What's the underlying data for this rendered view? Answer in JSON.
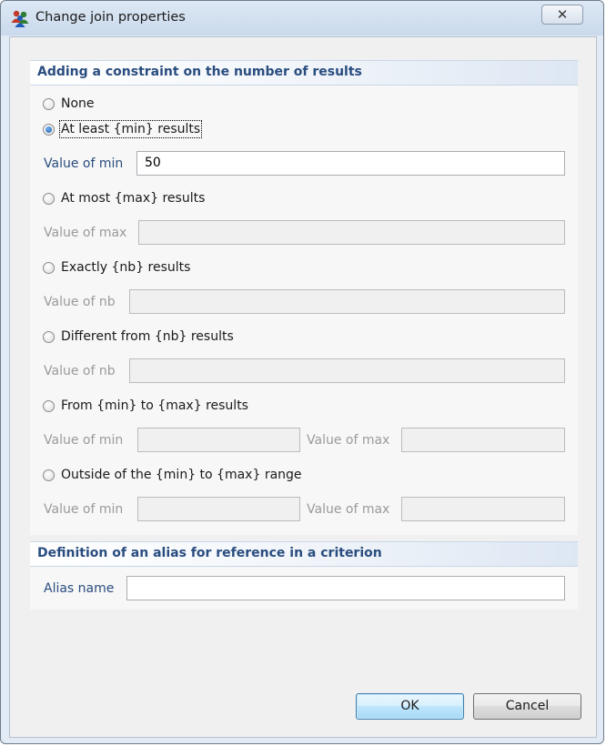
{
  "window": {
    "title": "Change join properties",
    "close_label": "✕"
  },
  "constraint_section": {
    "title": "Adding a constraint on the number of results",
    "options": [
      {
        "label": "None",
        "checked": false
      },
      {
        "label": "At least {min} results",
        "checked": true
      },
      {
        "label": "At most {max} results",
        "checked": false
      },
      {
        "label": "Exactly {nb} results",
        "checked": false
      },
      {
        "label": "Different from {nb} results",
        "checked": false
      },
      {
        "label": "From {min} to {max} results",
        "checked": false
      },
      {
        "label": "Outside of the {min} to {max} range",
        "checked": false
      }
    ],
    "at_least": {
      "min_label": "Value of min",
      "min_value": "50"
    },
    "at_most": {
      "max_label": "Value of max",
      "max_value": ""
    },
    "exactly": {
      "nb_label": "Value of nb",
      "nb_value": ""
    },
    "different": {
      "nb_label": "Value of nb",
      "nb_value": ""
    },
    "from_to": {
      "min_label": "Value of min",
      "min_value": "",
      "max_label": "Value of max",
      "max_value": ""
    },
    "outside": {
      "min_label": "Value of min",
      "min_value": "",
      "max_label": "Value of max",
      "max_value": ""
    }
  },
  "alias_section": {
    "title": "Definition of an alias for reference in a criterion",
    "alias_label": "Alias name",
    "alias_value": ""
  },
  "buttons": {
    "ok": "OK",
    "cancel": "Cancel"
  }
}
